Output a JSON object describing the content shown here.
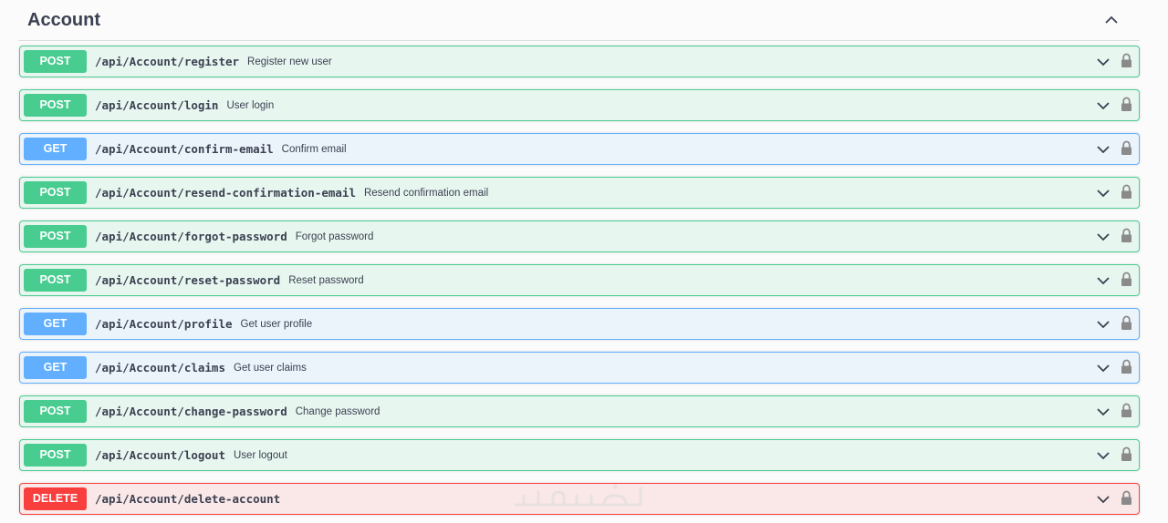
{
  "section": {
    "title": "Account"
  },
  "operations": [
    {
      "method": "POST",
      "path": "/api/Account/register",
      "summary": "Register new user"
    },
    {
      "method": "POST",
      "path": "/api/Account/login",
      "summary": "User login"
    },
    {
      "method": "GET",
      "path": "/api/Account/confirm-email",
      "summary": "Confirm email"
    },
    {
      "method": "POST",
      "path": "/api/Account/resend-confirmation-email",
      "summary": "Resend confirmation email"
    },
    {
      "method": "POST",
      "path": "/api/Account/forgot-password",
      "summary": "Forgot password"
    },
    {
      "method": "POST",
      "path": "/api/Account/reset-password",
      "summary": "Reset password"
    },
    {
      "method": "GET",
      "path": "/api/Account/profile",
      "summary": "Get user profile"
    },
    {
      "method": "GET",
      "path": "/api/Account/claims",
      "summary": "Get user claims"
    },
    {
      "method": "POST",
      "path": "/api/Account/change-password",
      "summary": "Change password"
    },
    {
      "method": "POST",
      "path": "/api/Account/logout",
      "summary": "User logout"
    },
    {
      "method": "DELETE",
      "path": "/api/Account/delete-account",
      "summary": ""
    }
  ],
  "icons": {
    "collapse": "chevron-up-icon",
    "expand": "chevron-down-icon",
    "lock": "lock-icon"
  },
  "colors": {
    "post": "#49cc90",
    "get": "#61affe",
    "delete": "#f93e3e"
  },
  "watermark": {
    "text": "خمسات"
  }
}
